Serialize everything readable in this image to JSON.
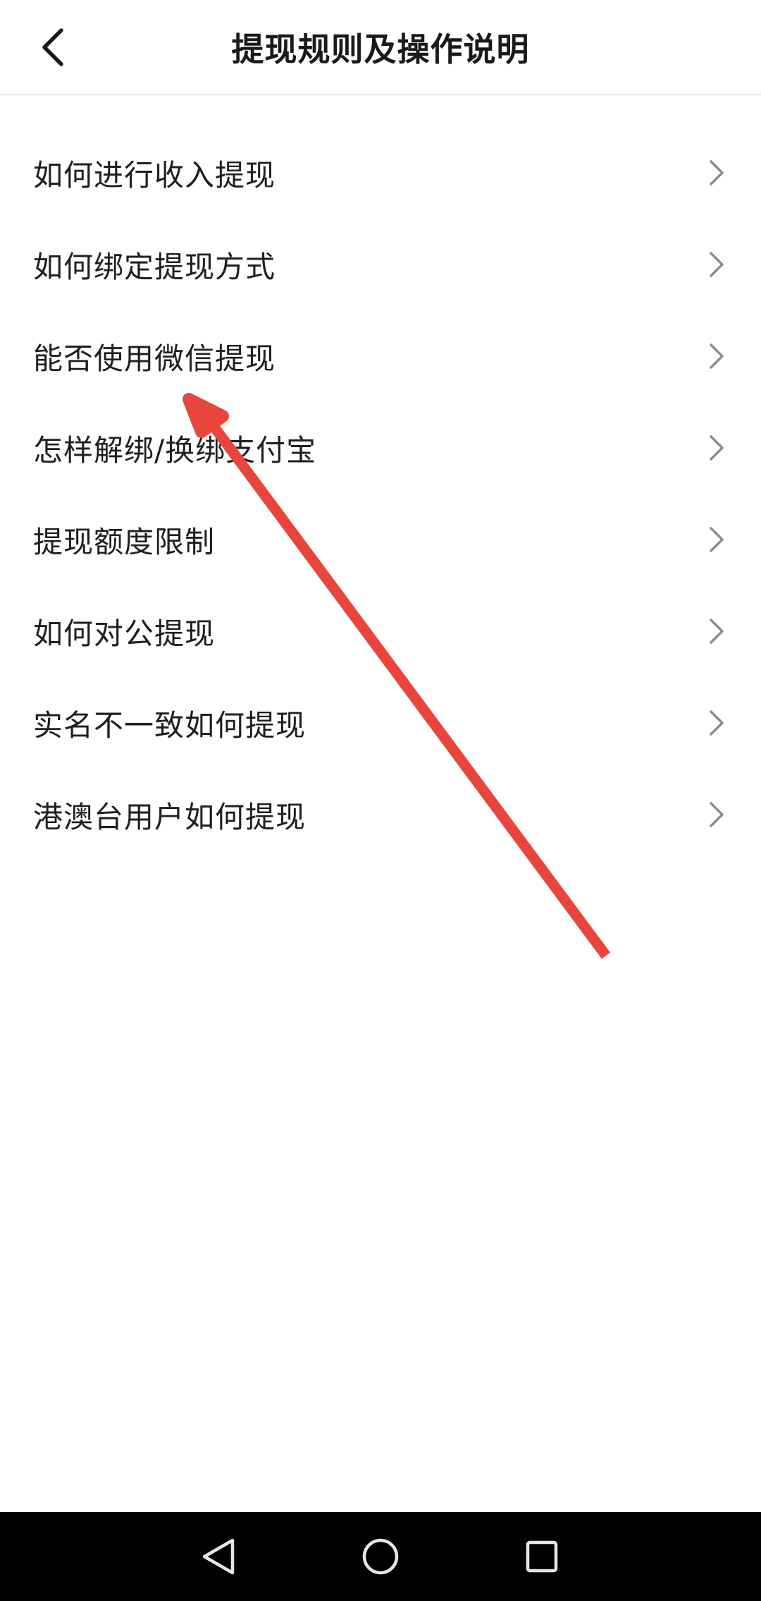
{
  "header": {
    "title": "提现规则及操作说明",
    "back_icon": "chevron-left-icon"
  },
  "faq": {
    "items": [
      {
        "label": "如何进行收入提现"
      },
      {
        "label": "如何绑定提现方式"
      },
      {
        "label": "能否使用微信提现"
      },
      {
        "label": "怎样解绑/换绑支付宝"
      },
      {
        "label": "提现额度限制"
      },
      {
        "label": "如何对公提现"
      },
      {
        "label": "实名不一致如何提现"
      },
      {
        "label": "港澳台用户如何提现"
      }
    ],
    "chevron_icon": "chevron-right-icon"
  },
  "annotation": {
    "type": "arrow",
    "color": "#e8453c"
  },
  "nav_bar": {
    "buttons": [
      "back-triangle-icon",
      "home-circle-icon",
      "recents-square-icon"
    ]
  },
  "colors": {
    "background": "#ffffff",
    "text": "#1f1f1f",
    "chevron": "#8c8c8c",
    "divider": "#ececec",
    "nav_bar": "#000000"
  }
}
